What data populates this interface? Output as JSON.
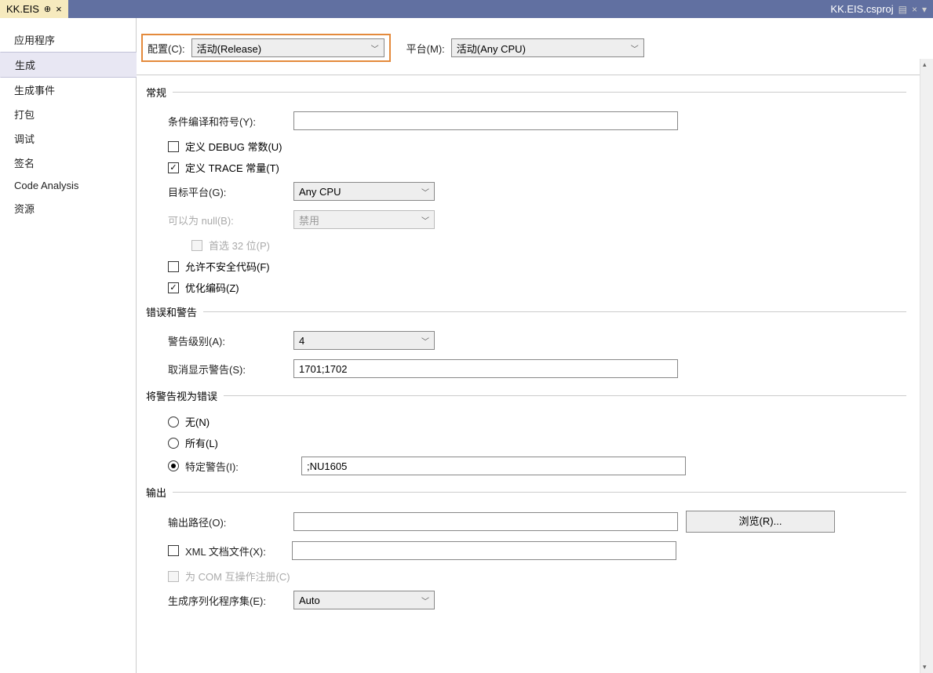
{
  "tab": {
    "title": "KK.EIS",
    "close": "×"
  },
  "topRight": {
    "file": "KK.EIS.csproj",
    "close": "×"
  },
  "sidebar": {
    "items": [
      {
        "label": "应用程序"
      },
      {
        "label": "生成"
      },
      {
        "label": "生成事件"
      },
      {
        "label": "打包"
      },
      {
        "label": "调试"
      },
      {
        "label": "签名"
      },
      {
        "label": "Code Analysis"
      },
      {
        "label": "资源"
      }
    ]
  },
  "config": {
    "configLabel": "配置(C):",
    "configValue": "活动(Release)",
    "platformLabel": "平台(M):",
    "platformValue": "活动(Any CPU)"
  },
  "sections": {
    "general": {
      "title": "常规",
      "condSymbolsLabel": "条件编译和符号(Y):",
      "condSymbolsValue": "",
      "defineDebug": "定义 DEBUG 常数(U)",
      "defineTrace": "定义 TRACE 常量(T)",
      "targetPlatformLabel": "目标平台(G):",
      "targetPlatformValue": "Any CPU",
      "nullableLabel": "可以为 null(B):",
      "nullableValue": "禁用",
      "prefer32": "首选 32 位(P)",
      "allowUnsafe": "允许不安全代码(F)",
      "optimize": "优化编码(Z)"
    },
    "errors": {
      "title": "错误和警告",
      "warnLevelLabel": "警告级别(A):",
      "warnLevelValue": "4",
      "suppressLabel": "取消显示警告(S):",
      "suppressValue": "1701;1702"
    },
    "treatAsError": {
      "title": "将警告视为错误",
      "none": "无(N)",
      "all": "所有(L)",
      "specificLabel": "特定警告(I):",
      "specificValue": ";NU1605"
    },
    "output": {
      "title": "输出",
      "pathLabel": "输出路径(O):",
      "pathValue": "",
      "browse": "浏览(R)...",
      "xmlDoc": "XML 文档文件(X):",
      "xmlDocValue": "",
      "comReg": "为 COM 互操作注册(C)",
      "serAsmLabel": "生成序列化程序集(E):",
      "serAsmValue": "Auto"
    }
  }
}
